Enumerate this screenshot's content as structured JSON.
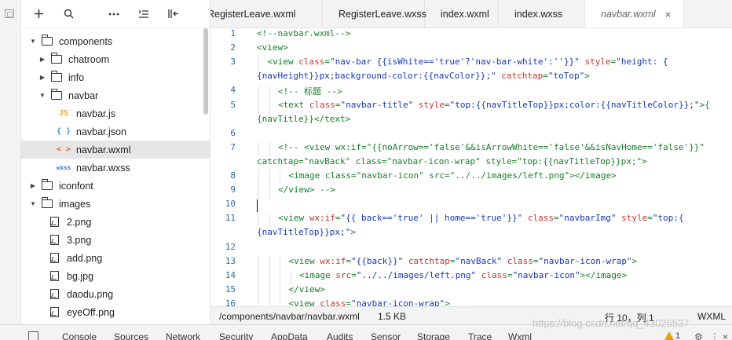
{
  "toolbar": {
    "add_icon": "plus-icon",
    "search_icon": "search-icon",
    "more_icon": "ellipsis-icon",
    "sort_icon": "sort-icon",
    "collapse_icon": "collapse-panel-icon"
  },
  "tree": [
    {
      "label": "components",
      "type": "folder",
      "expanded": true,
      "depth": 0
    },
    {
      "label": "chatroom",
      "type": "folder",
      "expanded": false,
      "depth": 1
    },
    {
      "label": "info",
      "type": "folder",
      "expanded": false,
      "depth": 1
    },
    {
      "label": "navbar",
      "type": "folder",
      "expanded": true,
      "depth": 1
    },
    {
      "label": "navbar.js",
      "type": "js",
      "icon_text": "JS",
      "depth": 2
    },
    {
      "label": "navbar.json",
      "type": "json",
      "icon_text": "{ }",
      "depth": 2
    },
    {
      "label": "navbar.wxml",
      "type": "wxml",
      "icon_text": "< >",
      "depth": 2,
      "selected": true
    },
    {
      "label": "navbar.wxss",
      "type": "wxss",
      "icon_text": "wxss",
      "depth": 2
    },
    {
      "label": "iconfont",
      "type": "folder",
      "expanded": false,
      "depth": 0
    },
    {
      "label": "images",
      "type": "folder",
      "expanded": true,
      "depth": 0
    },
    {
      "label": "2.png",
      "type": "image",
      "depth": 1
    },
    {
      "label": "3.png",
      "type": "image",
      "depth": 1
    },
    {
      "label": "add.png",
      "type": "image",
      "depth": 1
    },
    {
      "label": "bg.jpg",
      "type": "image",
      "depth": 1
    },
    {
      "label": "daodu.png",
      "type": "image",
      "depth": 1
    },
    {
      "label": "eyeOff.png",
      "type": "image",
      "depth": 1
    }
  ],
  "tabs": [
    {
      "label": "RegisterLeave.wxml",
      "active": false
    },
    {
      "label": "RegisterLeave.wxss",
      "active": false
    },
    {
      "label": "index.wxml",
      "active": false
    },
    {
      "label": "index.wxss",
      "active": false
    },
    {
      "label": "navbar.wxml",
      "active": true,
      "close": "×"
    }
  ],
  "code": [
    {
      "n": "1",
      "indent": 0,
      "tokens": [
        [
          "cmt",
          "<!--navbar.wxml-->"
        ]
      ]
    },
    {
      "n": "2",
      "indent": 0,
      "tokens": [
        [
          "tag",
          "<view>"
        ]
      ]
    },
    {
      "n": "3",
      "indent": 1,
      "tokens": [
        [
          "tag",
          "<view "
        ],
        [
          "attr",
          "class"
        ],
        [
          "tag",
          "="
        ],
        [
          "str",
          "\"nav-bar {{isWhite=='true'?'nav-bar-white':''}}\""
        ],
        [
          "tag",
          " "
        ],
        [
          "attr",
          "style"
        ],
        [
          "tag",
          "="
        ],
        [
          "str",
          "\"height: {"
        ]
      ]
    },
    {
      "n": "",
      "indent": 0,
      "tokens": [
        [
          "str",
          "{navHeight}}px;background-color:{{navColor}};\""
        ],
        [
          "tag",
          " "
        ],
        [
          "attr",
          "catchtap"
        ],
        [
          "tag",
          "="
        ],
        [
          "str",
          "\"toTop\""
        ],
        [
          "tag",
          ">"
        ]
      ]
    },
    {
      "n": "4",
      "indent": 2,
      "tokens": [
        [
          "cmt",
          "<!-- 标题 -->"
        ]
      ]
    },
    {
      "n": "5",
      "indent": 2,
      "tokens": [
        [
          "tag",
          "<text "
        ],
        [
          "attr",
          "class"
        ],
        [
          "tag",
          "="
        ],
        [
          "str",
          "\"navbar-title\""
        ],
        [
          "tag",
          " "
        ],
        [
          "attr",
          "style"
        ],
        [
          "tag",
          "="
        ],
        [
          "str",
          "\"top:{{navTitleTop}}px;color:{{navTitleColor}};\""
        ],
        [
          "tag",
          ">{"
        ]
      ]
    },
    {
      "n": "",
      "indent": 0,
      "tokens": [
        [
          "tag",
          "{navTitle}}</text>"
        ]
      ]
    },
    {
      "n": "6",
      "indent": 0,
      "tokens": []
    },
    {
      "n": "7",
      "indent": 2,
      "tokens": [
        [
          "cmt",
          "<!-- <view wx:if=\"{{noArrow=='false'&&isArrowWhite=='false'&&isNavHome=='false'}}\""
        ]
      ]
    },
    {
      "n": "",
      "indent": 0,
      "tokens": [
        [
          "cmt",
          "catchtap=\"navBack\" class=\"navbar-icon-wrap\" style=\"top:{{navTitleTop}}px;\">"
        ]
      ]
    },
    {
      "n": "8",
      "indent": 3,
      "tokens": [
        [
          "cmt",
          "<image class=\"navbar-icon\" src=\"../../images/left.png\"></image>"
        ]
      ]
    },
    {
      "n": "9",
      "indent": 2,
      "tokens": [
        [
          "cmt",
          "</view> -->"
        ]
      ]
    },
    {
      "n": "10",
      "indent": 0,
      "tokens": []
    },
    {
      "n": "11",
      "indent": 2,
      "tokens": [
        [
          "tag",
          "<view "
        ],
        [
          "attr",
          "wx:if"
        ],
        [
          "tag",
          "="
        ],
        [
          "str",
          "\"{{ back=='true' || home=='true'}}\""
        ],
        [
          "tag",
          " "
        ],
        [
          "attr",
          "class"
        ],
        [
          "tag",
          "="
        ],
        [
          "str",
          "\"navbarImg\""
        ],
        [
          "tag",
          " "
        ],
        [
          "attr",
          "style"
        ],
        [
          "tag",
          "="
        ],
        [
          "str",
          "\"top:{"
        ]
      ]
    },
    {
      "n": "",
      "indent": 0,
      "tokens": [
        [
          "str",
          "{navTitleTop}}px;\""
        ],
        [
          "tag",
          ">"
        ]
      ]
    },
    {
      "n": "12",
      "indent": 0,
      "tokens": []
    },
    {
      "n": "13",
      "indent": 3,
      "tokens": [
        [
          "tag",
          "<view "
        ],
        [
          "attr",
          "wx:if"
        ],
        [
          "tag",
          "="
        ],
        [
          "str",
          "\"{{back}}\""
        ],
        [
          "tag",
          " "
        ],
        [
          "attr",
          "catchtap"
        ],
        [
          "tag",
          "="
        ],
        [
          "str",
          "\"navBack\""
        ],
        [
          "tag",
          " "
        ],
        [
          "attr",
          "class"
        ],
        [
          "tag",
          "="
        ],
        [
          "str",
          "\"navbar-icon-wrap\""
        ],
        [
          "tag",
          ">"
        ]
      ]
    },
    {
      "n": "14",
      "indent": 4,
      "tokens": [
        [
          "tag",
          "<image "
        ],
        [
          "attr",
          "src"
        ],
        [
          "tag",
          "="
        ],
        [
          "str",
          "\"../../images/left.png\""
        ],
        [
          "tag",
          " "
        ],
        [
          "attr",
          "class"
        ],
        [
          "tag",
          "="
        ],
        [
          "str",
          "\"navbar-icon\""
        ],
        [
          "tag",
          "></image>"
        ]
      ]
    },
    {
      "n": "15",
      "indent": 3,
      "tokens": [
        [
          "tag",
          "</view>"
        ]
      ]
    },
    {
      "n": "16",
      "indent": 3,
      "tokens": [
        [
          "tag",
          "<view "
        ],
        [
          "attr",
          "class"
        ],
        [
          "tag",
          "="
        ],
        [
          "str",
          "\"navbar-icon-wrap\""
        ],
        [
          "tag",
          ">"
        ]
      ]
    }
  ],
  "status": {
    "path": "/components/navbar/navbar.wxml",
    "size": "1.5 KB",
    "position": "行 10，列 1",
    "language": "WXML"
  },
  "devtools": {
    "tabs": [
      "Console",
      "Sources",
      "Network",
      "Security",
      "AppData",
      "Audits",
      "Sensor",
      "Storage",
      "Trace",
      "Wxml"
    ],
    "warnings": "1",
    "warning_icon": "warning-icon"
  },
  "watermark": "https://blog.csdn.net/qq_43026537"
}
